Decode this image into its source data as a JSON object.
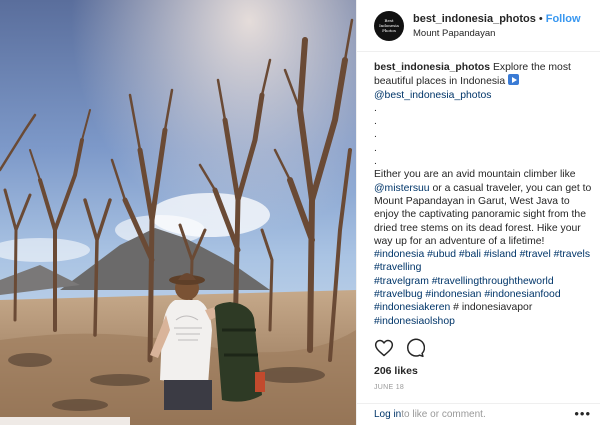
{
  "header": {
    "avatar_lines": [
      "Best",
      "Indonesia",
      "Photos"
    ],
    "username": "best_indonesia_photos",
    "separator": "•",
    "follow_label": "Follow",
    "location": "Mount Papandayan"
  },
  "caption": {
    "username": "best_indonesia_photos",
    "intro": " Explore the most beautiful places in Indonesia ",
    "mention_main": "@best_indonesia_photos",
    "dots": [
      ".",
      ".",
      ".",
      ".",
      "."
    ],
    "body_start": "Either you are an avid mountain climber like ",
    "body_mention": "@mistersuu",
    "body_end": " or a casual traveler, you can get to Mount Papandayan in Garut, West Java to enjoy the captivating panoramic sight from the dried tree stems on its dead forest. Hike your way up for an adventure of a lifetime!",
    "tags_line1": "#indonesia #ubud #bali #island #travel #travels",
    "tags_line2": "#travelling",
    "tags_line3": "#travelgram #travellingthroughtheworld",
    "tags_line4": "#travelbug #indonesian #indonesianfood",
    "tags_line5_link": "#indonesiakeren",
    "tags_line5_text": " # indonesiavapor",
    "tags_line6": "#indonesiaolshop"
  },
  "actions": {
    "like_icon": "heart-icon",
    "comment_icon": "comment-bubble-icon"
  },
  "likes": "206 likes",
  "date": "JUNE 18",
  "comment": {
    "login_label": "Log in",
    "prompt": " to like or comment.",
    "more_label": "•••"
  },
  "colors": {
    "link": "#003569",
    "follow": "#3897f0",
    "muted": "#999999",
    "text": "#262626"
  }
}
